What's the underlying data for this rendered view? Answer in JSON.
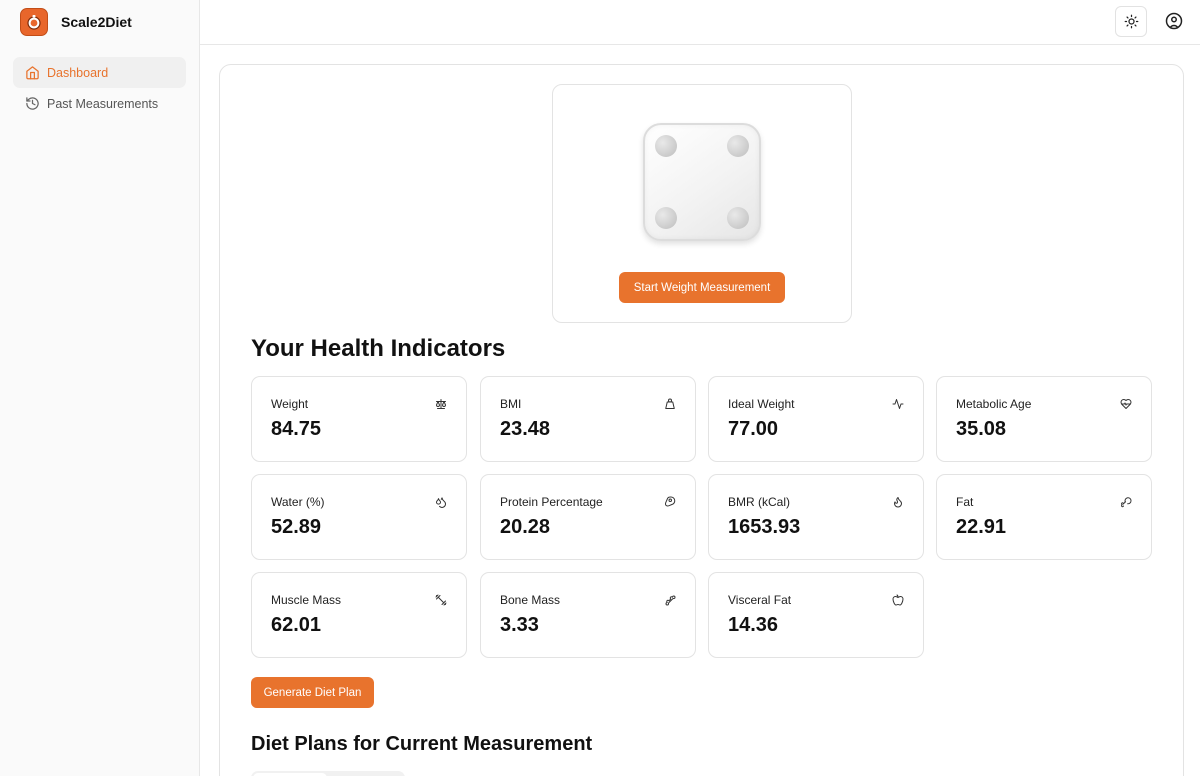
{
  "app": {
    "name": "Scale2Diet"
  },
  "sidebar": {
    "items": [
      {
        "label": "Dashboard",
        "icon": "home-icon",
        "active": true
      },
      {
        "label": "Past Measurements",
        "icon": "history-icon",
        "active": false
      }
    ]
  },
  "header": {
    "theme_icon": "sun-icon",
    "user_icon": "user-circle-icon"
  },
  "scale": {
    "image": "smart-scale",
    "button_label": "Start Weight Measurement"
  },
  "indicators": {
    "title": "Your Health Indicators",
    "items": [
      {
        "label": "Weight",
        "value": "84.75",
        "icon": "scale-icon"
      },
      {
        "label": "BMI",
        "value": "23.48",
        "icon": "weight-icon"
      },
      {
        "label": "Ideal Weight",
        "value": "77.00",
        "icon": "activity-icon"
      },
      {
        "label": "Metabolic Age",
        "value": "35.08",
        "icon": "heart-pulse-icon"
      },
      {
        "label": "Water (%)",
        "value": "52.89",
        "icon": "droplets-icon"
      },
      {
        "label": "Protein Percentage",
        "value": "20.28",
        "icon": "beef-icon"
      },
      {
        "label": "BMR (kCal)",
        "value": "1653.93",
        "icon": "flame-icon"
      },
      {
        "label": "Fat",
        "value": "22.91",
        "icon": "drumstick-icon"
      },
      {
        "label": "Muscle Mass",
        "value": "62.01",
        "icon": "dumbbell-icon"
      },
      {
        "label": "Bone Mass",
        "value": "3.33",
        "icon": "bone-icon"
      },
      {
        "label": "Visceral Fat",
        "value": "14.36",
        "icon": "apple-icon"
      }
    ]
  },
  "actions": {
    "generate_label": "Generate Diet Plan"
  },
  "diet_plans": {
    "title": "Diet Plans for Current Measurement"
  },
  "colors": {
    "accent": "#e8732d",
    "border": "#e3e3e3"
  }
}
